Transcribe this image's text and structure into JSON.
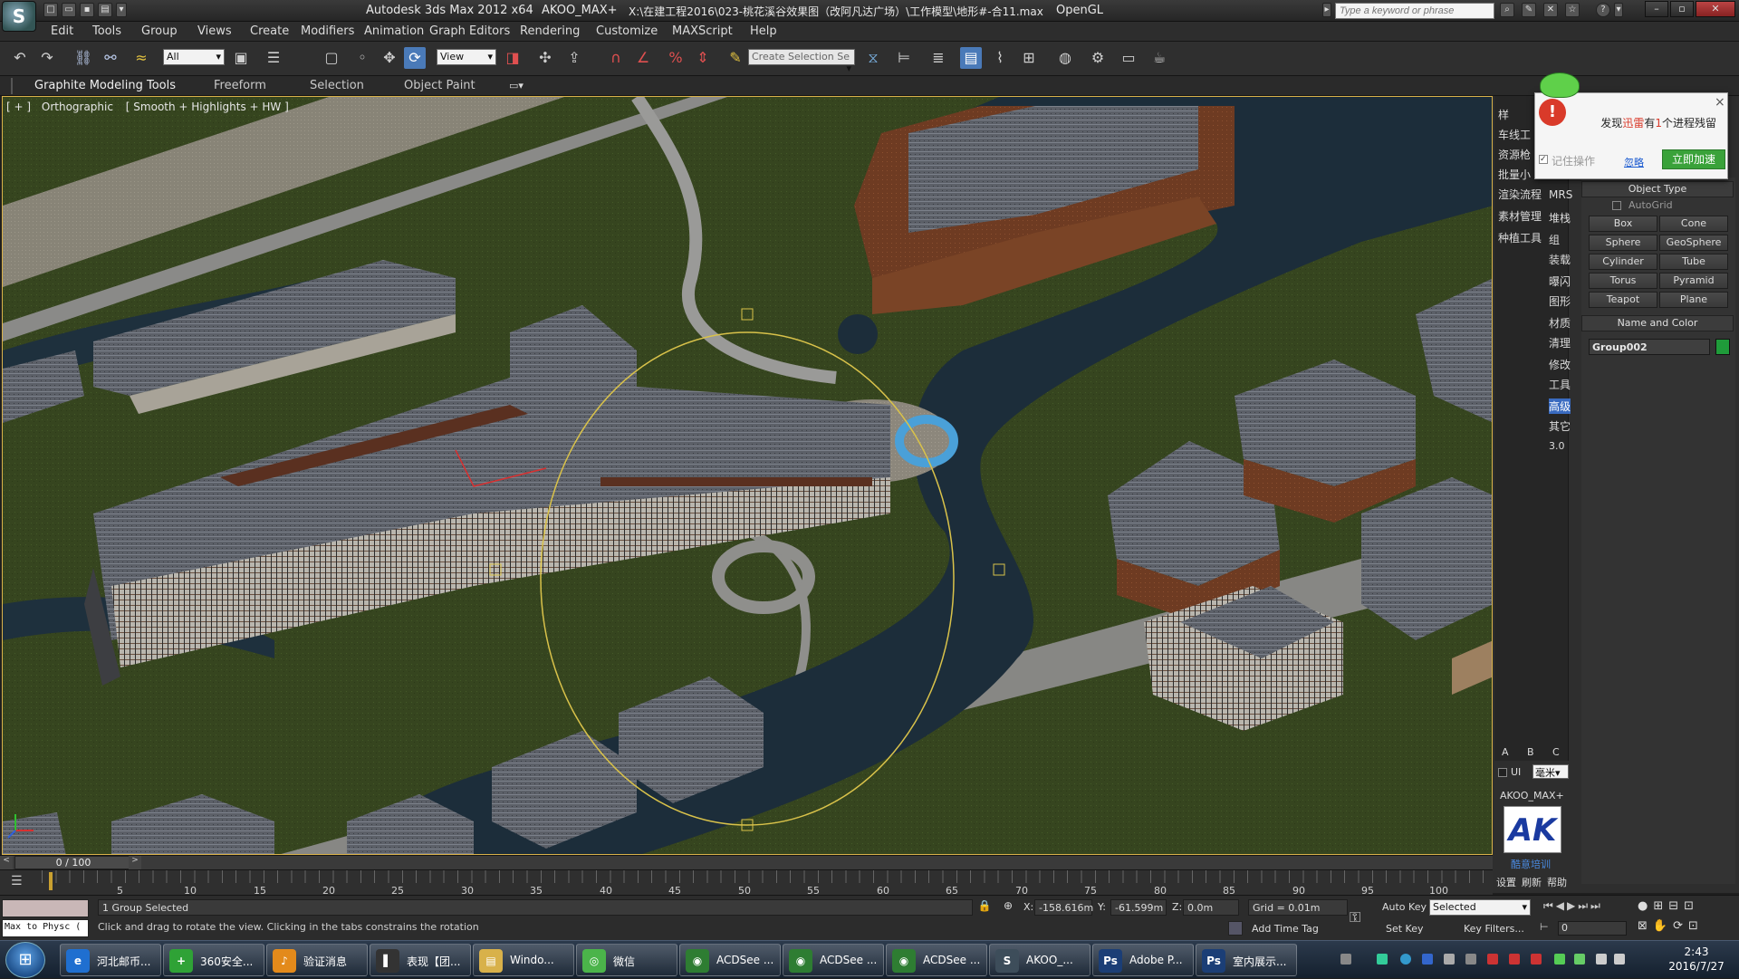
{
  "window": {
    "app_title": "Autodesk 3ds Max  2012 x64",
    "plugin_name": "AKOO_MAX+",
    "file_path": "X:\\在建工程2016\\023-桃花溪谷效果图（改阿凡达广场）\\工作模型\\地形#-合11.max",
    "renderer": "OpenGL",
    "search_placeholder": "Type a keyword or phrase",
    "logo_letter": "S"
  },
  "menu": [
    "Edit",
    "Tools",
    "Group",
    "Views",
    "Create",
    "Modifiers",
    "Animation",
    "Graph Editors",
    "Rendering",
    "Customize",
    "MAXScript",
    "Help"
  ],
  "toolbar": {
    "selection_filter": "All",
    "ref_coord": "View",
    "named_selection_placeholder": "Create Selection Se"
  },
  "ribbon_tabs": [
    "Graphite Modeling Tools",
    "Freeform",
    "Selection",
    "Object Paint"
  ],
  "viewport": {
    "label_plus": "[ + ]",
    "label_view": "Orthographic",
    "label_shading": "[ Smooth + Highlights + HW ]",
    "label_close": "]"
  },
  "plugin_panel": {
    "items_left": [
      "样",
      "车线工",
      "资源枪",
      "批量小",
      "渲染流程",
      "素材管理",
      "种植工具"
    ],
    "items_right": [
      "MRS",
      "堆栈",
      "组",
      "装载",
      "曝闪",
      "图形",
      "材质",
      "清理",
      "修改",
      "工具",
      "高级",
      "其它",
      "3.0"
    ],
    "tabs": [
      "A",
      "B",
      "C"
    ],
    "ui_label": "UI",
    "unit_select": "毫米",
    "brand_name": "AKOO_MAX+",
    "brand_logo": "AK",
    "brand_caption": "酷意培训",
    "bottom_links": [
      "设置",
      "刷新",
      "帮助"
    ]
  },
  "popup": {
    "message_prefix": "发现",
    "message_brand": "迅雷",
    "message_mid": "有",
    "message_count": "1",
    "message_suffix": "个进程残留",
    "remember": "记住操作",
    "ignore": "忽略",
    "accelerate": "立即加速",
    "close": "×"
  },
  "command_panel": {
    "object_type_title": "Object Type",
    "autogrid": "AutoGrid",
    "primitives": [
      "Box",
      "Cone",
      "Sphere",
      "GeoSphere",
      "Cylinder",
      "Tube",
      "Torus",
      "Pyramid",
      "Teapot",
      "Plane"
    ],
    "name_color_title": "Name and Color",
    "object_name": "Group002",
    "object_color": "#1f9b3a"
  },
  "timeline": {
    "frame_counter": "0 / 100",
    "ticks": [
      "5",
      "10",
      "15",
      "20",
      "25",
      "30",
      "35",
      "40",
      "45",
      "50",
      "55",
      "60",
      "65",
      "70",
      "75",
      "80",
      "85",
      "90",
      "95",
      "100"
    ]
  },
  "status": {
    "listener": "Max to Physc (",
    "selection_info": "1 Group Selected",
    "prompt": "Click and drag to rotate the view.  Clicking in the tabs constrains the rotation",
    "x_label": "X:",
    "x_value": "-158.616m",
    "y_label": "Y:",
    "y_value": "-61.599m",
    "z_label": "Z:",
    "z_value": "0.0m",
    "grid": "Grid = 0.01m",
    "add_time_tag": "Add Time Tag",
    "auto_key": "Auto Key",
    "set_key": "Set Key",
    "key_mode": "Selected",
    "key_filters": "Key Filters...",
    "frame_value": "0"
  },
  "taskbar": {
    "items": [
      {
        "label": "河北邮币...",
        "icon": "e",
        "color": "#1f6fd0"
      },
      {
        "label": "360安全...",
        "icon": "+",
        "color": "#2fa236"
      },
      {
        "label": "验证消息",
        "icon": "♪",
        "color": "#e38a1b"
      },
      {
        "label": "表现【团...",
        "icon": "▌",
        "color": "#333333"
      },
      {
        "label": "Windo...",
        "icon": "▤",
        "color": "#d8b14a"
      },
      {
        "label": "微信",
        "icon": "◎",
        "color": "#4bb44a"
      },
      {
        "label": "ACDSee ...",
        "icon": "◉",
        "color": "#2e7d32"
      },
      {
        "label": "ACDSee ...",
        "icon": "◉",
        "color": "#2e7d32"
      },
      {
        "label": "ACDSee ...",
        "icon": "◉",
        "color": "#2e7d32"
      },
      {
        "label": "AKOO_...",
        "icon": "S",
        "color": "#3d4d5a"
      },
      {
        "label": "Adobe P...",
        "icon": "Ps",
        "color": "#1b3e76"
      },
      {
        "label": "室内展示...",
        "icon": "Ps",
        "color": "#1b3e76"
      }
    ],
    "time": "2:43",
    "date": "2016/7/27"
  },
  "colors": {
    "grass": "#37461f",
    "water": "#1c2d3a",
    "road": "#8a8a88",
    "roof": "#5a5e66",
    "accent_yellow": "#d9c24a"
  }
}
